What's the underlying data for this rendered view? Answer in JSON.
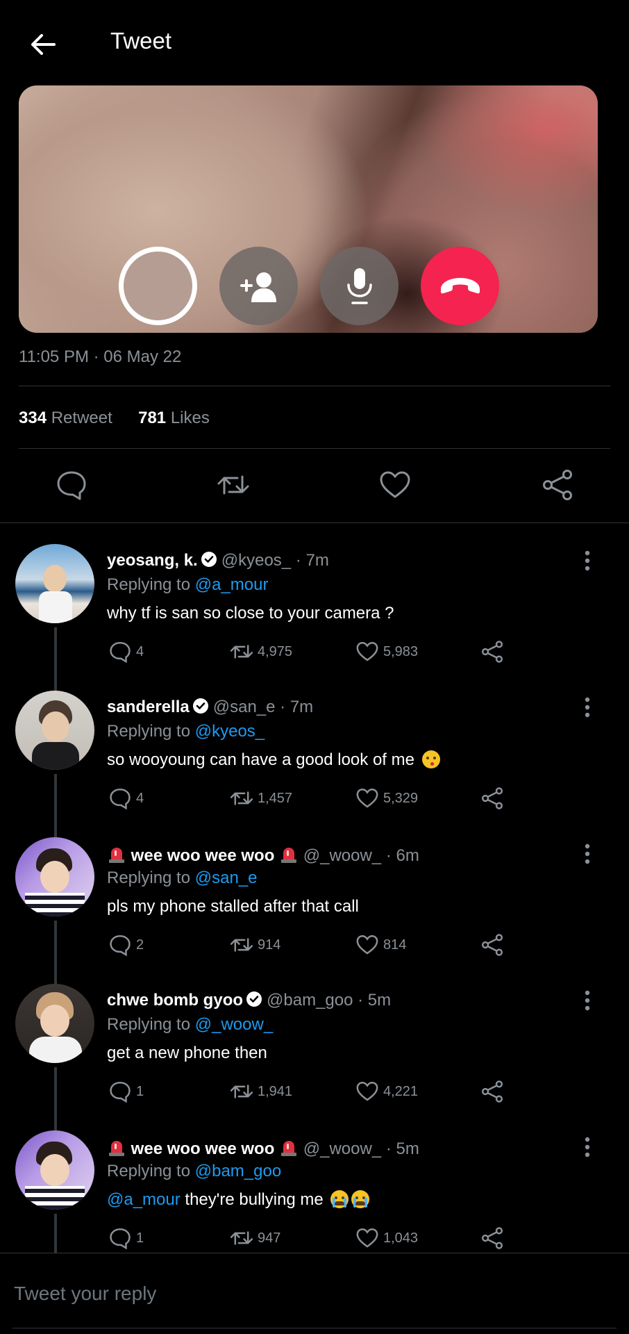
{
  "header": {
    "title": "Tweet",
    "back_icon": "arrow-left-icon"
  },
  "tweet": {
    "timestamp": "11:05 PM · 06 May 22",
    "retweets_count": "334",
    "retweets_label": "Retweet",
    "likes_count": "781",
    "likes_label": "Likes",
    "call_controls": [
      "camera-preview",
      "add-person-icon",
      "microphone-icon",
      "end-call-icon"
    ]
  },
  "colors": {
    "background": "#000000",
    "accent": "#1d9bf0",
    "end_call": "#f4234f",
    "muted": "#8b9197"
  },
  "replies": [
    {
      "name": "yeosang, k.",
      "verified": true,
      "handle_time": "@kyeos_ · 7m",
      "replying_label": "Replying to",
      "replying_to": "@a_mour",
      "text_mention": "",
      "text": "why tf is san so close to your camera ?",
      "emoji": "",
      "replies": "4",
      "retweets": "4,975",
      "likes": "5,983"
    },
    {
      "name": "sanderella",
      "verified": true,
      "handle_time": "@san_e · 7m",
      "replying_label": "Replying to",
      "replying_to": "@kyeos_",
      "text_mention": "",
      "text": "so wooyoung can have a good look of me",
      "emoji": "kiss",
      "replies": "4",
      "retweets": "1,457",
      "likes": "5,329"
    },
    {
      "name": "wee woo wee woo",
      "sirens": true,
      "handle_time": "@_woow_ · 6m",
      "replying_label": "Replying to",
      "replying_to": "@san_e",
      "text_mention": "",
      "text": "pls my phone stalled after that call",
      "emoji": "",
      "replies": "2",
      "retweets": "914",
      "likes": "814"
    },
    {
      "name": "chwe bomb gyoo",
      "verified": true,
      "handle_time": "@bam_goo · 5m",
      "replying_label": "Replying to",
      "replying_to": "@_woow_",
      "text_mention": "",
      "text": "get a new phone then",
      "emoji": "",
      "replies": "1",
      "retweets": "1,941",
      "likes": "4,221"
    },
    {
      "name": "wee woo wee woo",
      "sirens": true,
      "handle_time": "@_woow_ · 5m",
      "replying_label": "Replying to",
      "replying_to": "@bam_goo",
      "text_mention": "@a_mour",
      "text": " they're bullying me",
      "emoji": "cry-cry",
      "replies": "1",
      "retweets": "947",
      "likes": "1,043"
    }
  ],
  "composer": {
    "placeholder": "Tweet your reply"
  }
}
